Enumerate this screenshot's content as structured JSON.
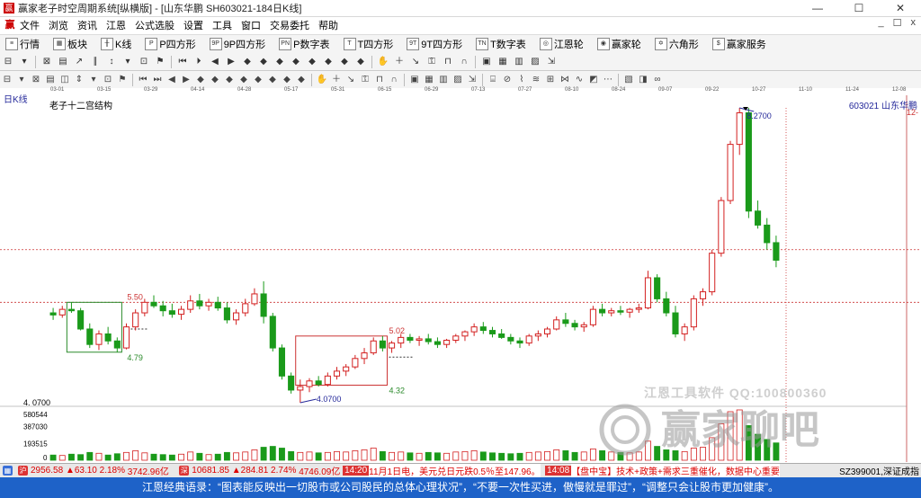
{
  "window": {
    "title": "赢家老子时空周期系统[纵横版] - [山东华鹏  SH603021-184日K线]",
    "min_label": "—",
    "max_label": "☐",
    "close_label": "✕"
  },
  "menu": {
    "items": [
      "文件",
      "浏览",
      "资讯",
      "江恩",
      "公式选股",
      "设置",
      "工具",
      "窗口",
      "交易委托",
      "帮助"
    ],
    "mdi": [
      "_",
      "☐",
      "x"
    ]
  },
  "toolbar1": {
    "items": [
      {
        "icon": "list-icon",
        "glyph": "≡",
        "label": "行情"
      },
      {
        "icon": "grid-icon",
        "glyph": "▦",
        "label": "板块"
      },
      {
        "icon": "kline-icon",
        "glyph": "╫",
        "label": "K线"
      },
      {
        "icon": "p-square-icon",
        "glyph": "P",
        "label": "P四方形"
      },
      {
        "icon": "9p-square-icon",
        "glyph": "9P",
        "label": "9P四方形"
      },
      {
        "icon": "pn-icon",
        "glyph": "PN",
        "label": "P数字表"
      },
      {
        "icon": "t-square-icon",
        "glyph": "T",
        "label": "T四方形"
      },
      {
        "icon": "9t-square-icon",
        "glyph": "9T",
        "label": "9T四方形"
      },
      {
        "icon": "tn-icon",
        "glyph": "TN",
        "label": "T数字表"
      },
      {
        "icon": "gann-wheel-icon",
        "glyph": "◎",
        "label": "江恩轮"
      },
      {
        "icon": "winner-wheel-icon",
        "glyph": "◉",
        "label": "赢家轮"
      },
      {
        "icon": "hexagon-icon",
        "glyph": "✡",
        "label": "六角形"
      },
      {
        "icon": "dollar-icon",
        "glyph": "$",
        "label": "赢家服务"
      }
    ]
  },
  "dates": [
    "03-01",
    "03-15",
    "03-29",
    "04-14",
    "04-28",
    "05-17",
    "05-31",
    "06-15",
    "06-29",
    "07-13",
    "07-27",
    "08-10",
    "08-24",
    "09-07",
    "09-22",
    "10-27",
    "11-10",
    "11-24",
    "12-08"
  ],
  "chart_labels": {
    "period": "日K线",
    "indicator": "老子十二宫结构",
    "stock": "603021  山东华鹏",
    "right_scale": "12-",
    "price_550": "5.50",
    "price_479": "4.79",
    "price_502": "5.02",
    "price_432": "4.32",
    "price_low": "4.0700",
    "price_high": "8.2700",
    "axis_low": "4. 0700",
    "vol1": "580544",
    "vol2": "387030",
    "vol3": "193515",
    "vol4": "0"
  },
  "watermark": {
    "text": "江恩工具软件  QQ:100800360",
    "logo_text": "赢家聊吧"
  },
  "status": {
    "sh_index": "2956.58",
    "sh_change": "▲63.10",
    "sh_pct": "2.18%",
    "sh_amount": "3742.96亿",
    "sz_index": "10681.85",
    "sz_change": "▲284.81",
    "sz_pct": "2.74%",
    "sz_amount": "4746.09亿",
    "news1_time": "14:20",
    "news1": "11月1日电，美元兑日元跌0.5％至147.96。",
    "news2_time": "14:08",
    "news2": "【盘中宝】技术+政策+需求三重催化，数据中心重要",
    "right_code": "SZ399001,深证成指"
  },
  "footer": {
    "quote": "江恩经典语录：“图表能反映出一切股市或公司股民的总体心理状况”，“不要一次性买进，傲慢就是罪过”，“调整只会让股市更加健康”。"
  },
  "colors": {
    "up": "#d32020",
    "down": "#1a9a1a",
    "box_green": "#2a8a2a",
    "box_red": "#cc3333",
    "label_blue": "#24289a",
    "footer_bg": "#1e62c8"
  },
  "chart_data": {
    "type": "candlestick",
    "title": "老子十二宫结构",
    "symbol": "603021 山东华鹏",
    "x_ticks": [
      "03-01",
      "03-15",
      "03-29",
      "04-14",
      "04-28",
      "05-17",
      "05-31",
      "06-15",
      "06-29",
      "07-13",
      "07-27",
      "08-10",
      "08-24",
      "09-07",
      "09-22",
      "10-27",
      "11-10",
      "11-24",
      "12-08"
    ],
    "ohlc": [
      [
        5.35,
        5.42,
        5.25,
        5.32
      ],
      [
        5.32,
        5.45,
        5.28,
        5.4
      ],
      [
        5.4,
        5.5,
        5.35,
        5.38
      ],
      [
        5.38,
        5.42,
        5.1,
        5.12
      ],
      [
        5.12,
        5.2,
        4.85,
        4.9
      ],
      [
        4.9,
        5.1,
        4.82,
        5.05
      ],
      [
        5.05,
        5.15,
        4.9,
        4.95
      ],
      [
        4.95,
        5.0,
        4.79,
        4.85
      ],
      [
        4.85,
        5.2,
        4.83,
        5.15
      ],
      [
        5.15,
        5.4,
        5.1,
        5.35
      ],
      [
        5.35,
        5.55,
        5.3,
        5.5
      ],
      [
        5.5,
        5.6,
        5.42,
        5.45
      ],
      [
        5.45,
        5.52,
        5.3,
        5.38
      ],
      [
        5.38,
        5.48,
        5.28,
        5.33
      ],
      [
        5.33,
        5.45,
        5.25,
        5.4
      ],
      [
        5.4,
        5.6,
        5.35,
        5.52
      ],
      [
        5.52,
        5.62,
        5.4,
        5.45
      ],
      [
        5.45,
        5.55,
        5.38,
        5.5
      ],
      [
        5.5,
        5.58,
        5.38,
        5.42
      ],
      [
        5.42,
        5.5,
        5.2,
        5.25
      ],
      [
        5.25,
        5.4,
        5.18,
        5.35
      ],
      [
        5.35,
        5.55,
        5.3,
        5.48
      ],
      [
        5.48,
        5.7,
        5.45,
        5.62
      ],
      [
        5.62,
        5.8,
        5.2,
        5.3
      ],
      [
        5.3,
        5.35,
        4.8,
        4.85
      ],
      [
        4.85,
        4.9,
        4.4,
        4.45
      ],
      [
        4.45,
        4.5,
        4.2,
        4.25
      ],
      [
        4.25,
        4.4,
        4.07,
        4.3
      ],
      [
        4.3,
        4.42,
        4.22,
        4.38
      ],
      [
        4.38,
        4.45,
        4.3,
        4.33
      ],
      [
        4.33,
        4.5,
        4.3,
        4.45
      ],
      [
        4.45,
        4.58,
        4.4,
        4.52
      ],
      [
        4.52,
        4.62,
        4.45,
        4.58
      ],
      [
        4.58,
        4.75,
        4.55,
        4.7
      ],
      [
        4.7,
        4.85,
        4.62,
        4.78
      ],
      [
        4.78,
        5.0,
        4.75,
        4.95
      ],
      [
        4.95,
        5.02,
        4.8,
        4.85
      ],
      [
        4.85,
        4.95,
        4.78,
        4.92
      ],
      [
        4.92,
        5.05,
        4.85,
        5.0
      ],
      [
        5.0,
        5.05,
        4.92,
        4.96
      ],
      [
        4.96,
        5.02,
        4.88,
        4.98
      ],
      [
        4.98,
        5.05,
        4.9,
        4.94
      ],
      [
        4.94,
        5.0,
        4.85,
        4.9
      ],
      [
        4.9,
        4.98,
        4.85,
        4.96
      ],
      [
        4.96,
        5.05,
        4.92,
        5.02
      ],
      [
        5.02,
        5.1,
        4.95,
        5.08
      ],
      [
        5.08,
        5.2,
        5.02,
        5.15
      ],
      [
        5.15,
        5.22,
        5.05,
        5.1
      ],
      [
        5.1,
        5.15,
        5.0,
        5.05
      ],
      [
        5.05,
        5.12,
        4.98,
        5.0
      ],
      [
        5.0,
        5.05,
        4.9,
        4.95
      ],
      [
        4.95,
        5.0,
        4.85,
        4.92
      ],
      [
        4.92,
        5.05,
        4.88,
        5.02
      ],
      [
        5.02,
        5.1,
        4.95,
        5.05
      ],
      [
        5.05,
        5.15,
        5.0,
        5.12
      ],
      [
        5.12,
        5.3,
        5.1,
        5.25
      ],
      [
        5.25,
        5.35,
        5.15,
        5.2
      ],
      [
        5.2,
        5.25,
        5.1,
        5.15
      ],
      [
        5.15,
        5.22,
        5.08,
        5.18
      ],
      [
        5.18,
        5.45,
        5.15,
        5.4
      ],
      [
        5.4,
        5.48,
        5.3,
        5.35
      ],
      [
        5.35,
        5.42,
        5.3,
        5.38
      ],
      [
        5.38,
        5.45,
        5.32,
        5.36
      ],
      [
        5.36,
        5.42,
        5.28,
        5.4
      ],
      [
        5.4,
        5.48,
        5.35,
        5.42
      ],
      [
        5.42,
        5.95,
        5.4,
        5.85
      ],
      [
        5.85,
        5.9,
        5.5,
        5.55
      ],
      [
        5.55,
        5.65,
        5.3,
        5.35
      ],
      [
        5.35,
        5.45,
        5.0,
        5.05
      ],
      [
        5.05,
        5.2,
        4.95,
        5.15
      ],
      [
        5.15,
        5.6,
        5.1,
        5.55
      ],
      [
        5.55,
        5.7,
        5.45,
        5.65
      ],
      [
        5.65,
        6.25,
        5.6,
        6.2
      ],
      [
        6.2,
        7.0,
        6.15,
        6.95
      ],
      [
        6.95,
        7.8,
        6.9,
        7.75
      ],
      [
        7.75,
        8.27,
        7.6,
        8.2
      ],
      [
        8.2,
        8.27,
        6.7,
        6.8
      ],
      [
        6.8,
        6.95,
        6.55,
        6.6
      ],
      [
        6.6,
        6.7,
        6.25,
        6.35
      ],
      [
        6.35,
        6.45,
        6.0,
        6.1
      ]
    ],
    "volume": [
      60000,
      55000,
      70000,
      65000,
      90000,
      80000,
      60000,
      75000,
      90000,
      110000,
      85000,
      70000,
      65000,
      60000,
      70000,
      95000,
      80000,
      65000,
      70000,
      90000,
      85000,
      95000,
      120000,
      150000,
      160000,
      140000,
      100000,
      90000,
      95000,
      85000,
      90000,
      100000,
      95000,
      110000,
      120000,
      140000,
      100000,
      90000,
      95000,
      85000,
      80000,
      90000,
      85000,
      80000,
      95000,
      100000,
      110000,
      95000,
      85000,
      80000,
      75000,
      80000,
      90000,
      95000,
      100000,
      120000,
      110000,
      90000,
      95000,
      130000,
      110000,
      95000,
      90000,
      85000,
      95000,
      220000,
      160000,
      120000,
      110000,
      100000,
      140000,
      150000,
      260000,
      420000,
      560000,
      580544,
      400000,
      300000,
      240000,
      200000
    ],
    "y_range": [
      4.07,
      8.27
    ],
    "volume_range": [
      0,
      580544
    ],
    "boxes": [
      {
        "label_top": "5.50",
        "label_bottom": "4.79",
        "color": "green"
      },
      {
        "label_top": "5.02",
        "label_bottom": "4.32",
        "color": "red"
      }
    ],
    "h_lines": [
      5.5,
      6.25
    ],
    "marks": {
      "low": "4.0700",
      "high": "8.2700"
    }
  }
}
